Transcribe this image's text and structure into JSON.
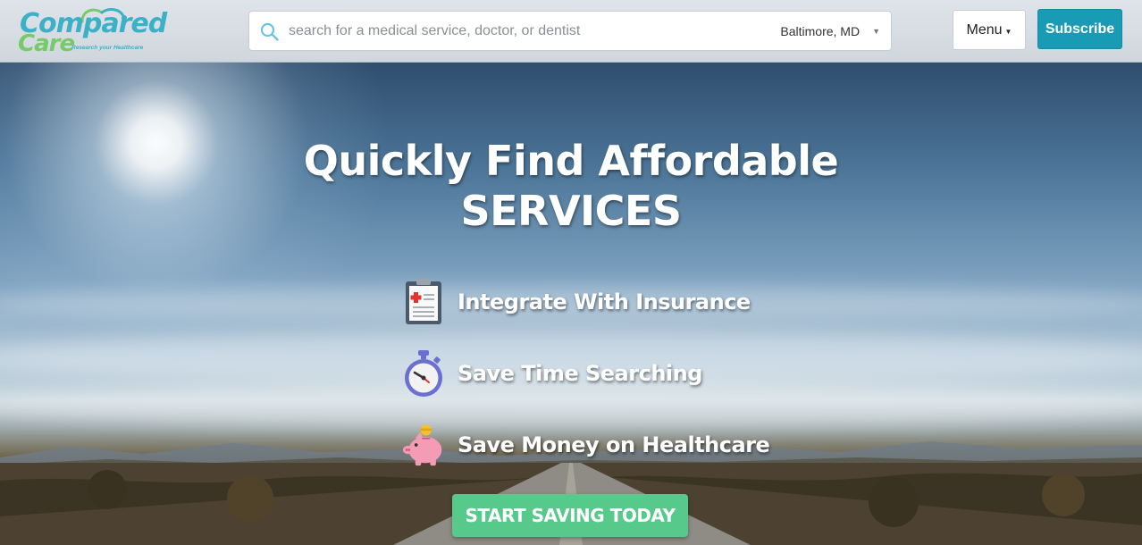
{
  "header": {
    "logo": {
      "name_top": "Compared",
      "name_bottom": "Care",
      "tagline": "Research your Healthcare"
    },
    "search": {
      "placeholder": "search for a medical service, doctor, or dentist",
      "value": "",
      "location": "Baltimore, MD"
    },
    "menu_label": "Menu",
    "subscribe_label": "Subscribe"
  },
  "hero": {
    "title_line1": "Quickly Find Affordable",
    "title_line2": "SERVICES",
    "features": [
      {
        "label": "Integrate With Insurance",
        "icon": "clipboard-icon"
      },
      {
        "label": "Save Time Searching",
        "icon": "stopwatch-icon"
      },
      {
        "label": "Save Money on Healthcare",
        "icon": "piggy-bank-icon"
      }
    ],
    "cta_label": "START SAVING TODAY"
  },
  "colors": {
    "brand_teal": "#3cb0c6",
    "brand_green": "#78c969",
    "subscribe": "#1a9bb5",
    "cta": "#56c98b"
  }
}
